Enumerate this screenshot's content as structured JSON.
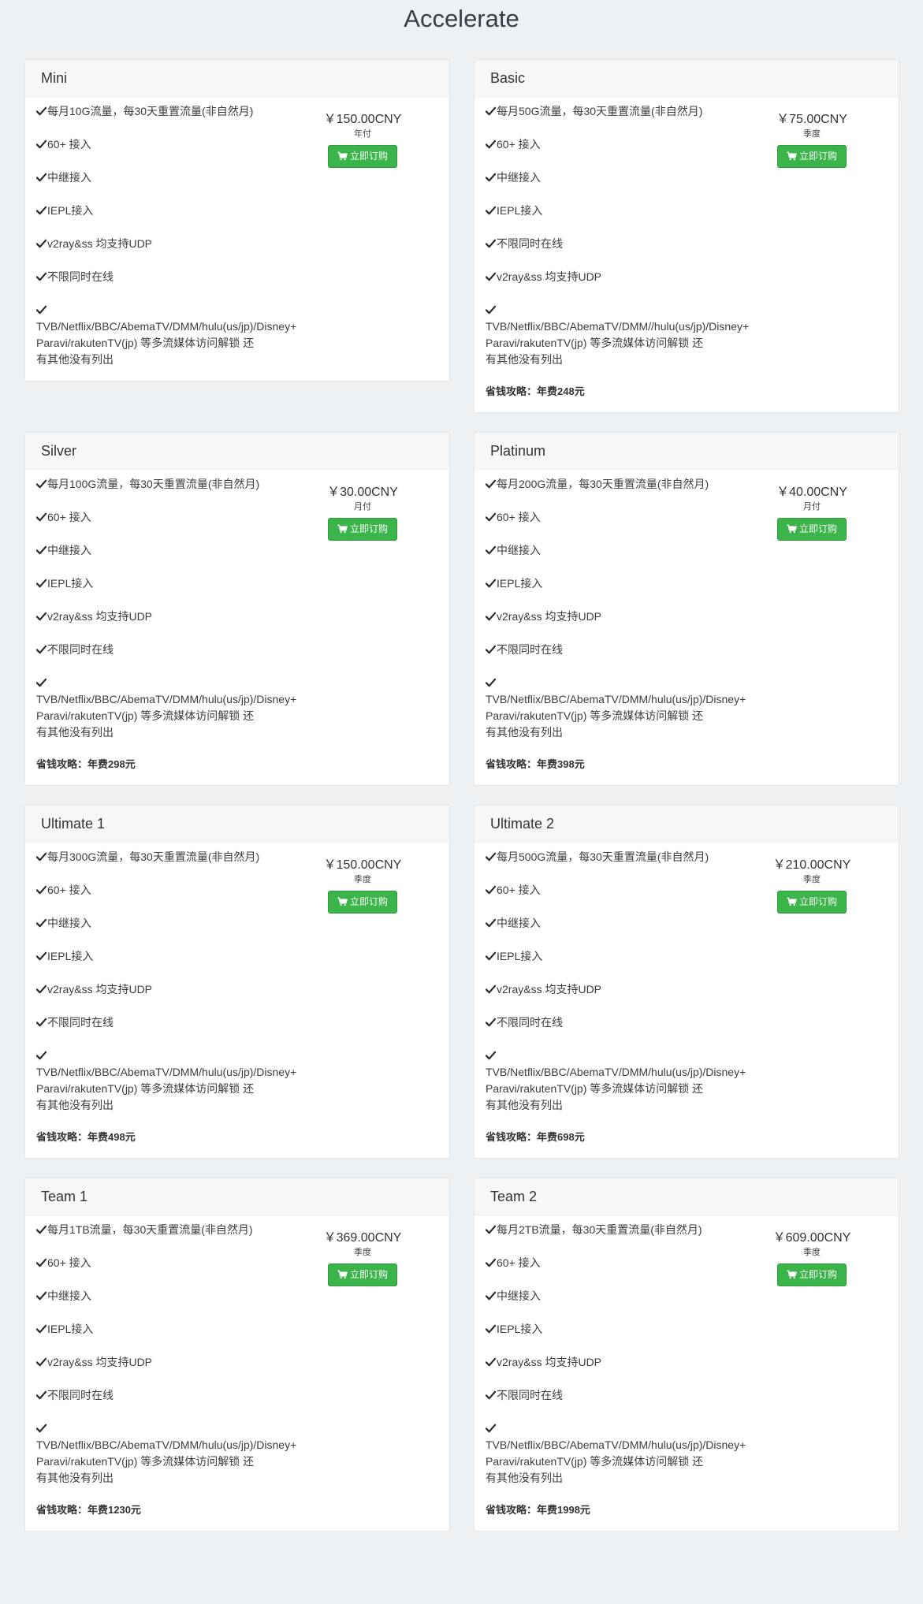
{
  "page": {
    "title": "Accelerate"
  },
  "common": {
    "buy_label": "立即订购"
  },
  "plans": [
    {
      "name": "Mini",
      "price": "￥150.00CNY",
      "period": "年付",
      "features": [
        "每月10G流量，每30天重置流量(非自然月)",
        "60+ 接入",
        "中继接入",
        "IEPL接入",
        "v2ray&ss 均支持UDP",
        "不限同时在线"
      ],
      "streaming": [
        "TVB/Netflix/BBC/AbemaTV/DMM/hulu(us/jp)/Disney+",
        "Paravi/rakutenTV(jp) 等多流媒体访问解锁 还",
        "有其他没有列出"
      ],
      "saving": ""
    },
    {
      "name": "Basic",
      "price": "￥75.00CNY",
      "period": "季度",
      "features": [
        "每月50G流量，每30天重置流量(非自然月)",
        "60+ 接入",
        "中继接入",
        "IEPL接入",
        "不限同时在线",
        "v2ray&ss 均支持UDP"
      ],
      "streaming": [
        "TVB/Netflix/BBC/AbemaTV/DMM//hulu(us/jp)/Disney+",
        "Paravi/rakutenTV(jp) 等多流媒体访问解锁 还",
        "有其他没有列出"
      ],
      "saving": "省钱攻略：年费248元"
    },
    {
      "name": "Silver",
      "price": "￥30.00CNY",
      "period": "月付",
      "features": [
        "每月100G流量，每30天重置流量(非自然月)",
        "60+ 接入",
        "中继接入",
        "IEPL接入",
        "v2ray&ss 均支持UDP",
        "不限同时在线"
      ],
      "streaming": [
        "TVB/Netflix/BBC/AbemaTV/DMM/hulu(us/jp)/Disney+",
        "Paravi/rakutenTV(jp) 等多流媒体访问解锁 还",
        "有其他没有列出"
      ],
      "saving": "省钱攻略：年费298元"
    },
    {
      "name": "Platinum",
      "price": "￥40.00CNY",
      "period": "月付",
      "features": [
        "每月200G流量，每30天重置流量(非自然月)",
        "60+ 接入",
        "中继接入",
        "IEPL接入",
        "v2ray&ss 均支持UDP",
        "不限同时在线"
      ],
      "streaming": [
        "TVB/Netflix/BBC/AbemaTV/DMM/hulu(us/jp)/Disney+",
        "Paravi/rakutenTV(jp) 等多流媒体访问解锁 还",
        "有其他没有列出"
      ],
      "saving": "省钱攻略：年费398元"
    },
    {
      "name": "Ultimate 1",
      "price": "￥150.00CNY",
      "period": "季度",
      "features": [
        "每月300G流量，每30天重置流量(非自然月)",
        "60+ 接入",
        "中继接入",
        "IEPL接入",
        "v2ray&ss 均支持UDP",
        "不限同时在线"
      ],
      "streaming": [
        "TVB/Netflix/BBC/AbemaTV/DMM/hulu(us/jp)/Disney+",
        "Paravi/rakutenTV(jp) 等多流媒体访问解锁 还",
        "有其他没有列出"
      ],
      "saving": "省钱攻略：年费498元"
    },
    {
      "name": "Ultimate 2",
      "price": "￥210.00CNY",
      "period": "季度",
      "features": [
        "每月500G流量，每30天重置流量(非自然月)",
        "60+ 接入",
        "中继接入",
        "IEPL接入",
        "v2ray&ss 均支持UDP",
        "不限同时在线"
      ],
      "streaming": [
        "TVB/Netflix/BBC/AbemaTV/DMM/hulu(us/jp)/Disney+",
        "Paravi/rakutenTV(jp) 等多流媒体访问解锁 还",
        "有其他没有列出"
      ],
      "saving": "省钱攻略：年费698元"
    },
    {
      "name": "Team 1",
      "price": "￥369.00CNY",
      "period": "季度",
      "features": [
        "每月1TB流量，每30天重置流量(非自然月)",
        "60+ 接入",
        "中继接入",
        "IEPL接入",
        "v2ray&ss 均支持UDP",
        "不限同时在线"
      ],
      "streaming": [
        "TVB/Netflix/BBC/AbemaTV/DMM/hulu(us/jp)/Disney+",
        "Paravi/rakutenTV(jp) 等多流媒体访问解锁 还",
        "有其他没有列出"
      ],
      "saving": "省钱攻略：年费1230元"
    },
    {
      "name": "Team 2",
      "price": "￥609.00CNY",
      "period": "季度",
      "features": [
        "每月2TB流量，每30天重置流量(非自然月)",
        "60+ 接入",
        "中继接入",
        "IEPL接入",
        "v2ray&ss 均支持UDP",
        "不限同时在线"
      ],
      "streaming": [
        "TVB/Netflix/BBC/AbemaTV/DMM/hulu(us/jp)/Disney+",
        "Paravi/rakutenTV(jp) 等多流媒体访问解锁 还",
        "有其他没有列出"
      ],
      "saving": "省钱攻略：年费1998元"
    }
  ]
}
